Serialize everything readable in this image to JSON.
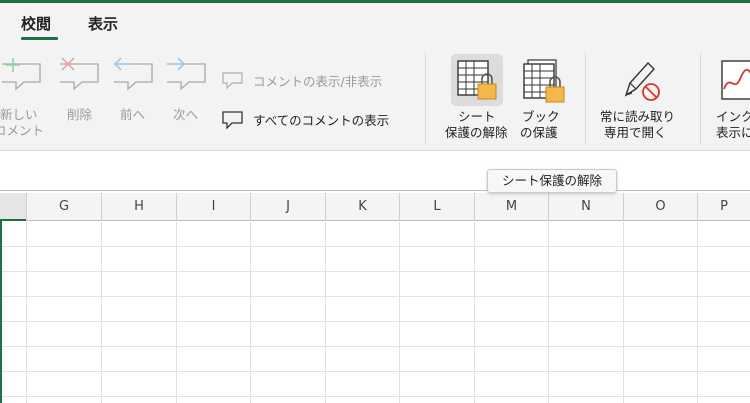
{
  "tabs": [
    {
      "label": "校閲",
      "active": true
    },
    {
      "label": "表示",
      "active": false
    }
  ],
  "ribbon": {
    "new_comment": {
      "line1": "新しい",
      "line2": "コメント",
      "enabled": false
    },
    "delete": {
      "label": "削除",
      "enabled": false
    },
    "prev": {
      "label": "前へ",
      "enabled": false
    },
    "next": {
      "label": "次へ",
      "enabled": false
    },
    "show_hide_comment": {
      "label": "コメントの表示/非表示",
      "enabled": false
    },
    "show_all_comments": {
      "label": "すべてのコメントの表示",
      "enabled": true
    },
    "unprotect_sheet": {
      "line1": "シート",
      "line2": "保護の解除",
      "pressed": true
    },
    "protect_workbook": {
      "line1": "ブック",
      "line2": "の保護"
    },
    "always_read_only": {
      "line1": "常に読み取り",
      "line2": "専用で開く"
    },
    "ink": {
      "line1": "インク",
      "line2": "表示に"
    }
  },
  "tooltip": {
    "text": "シート保護の解除"
  },
  "columns": [
    "G",
    "H",
    "I",
    "J",
    "K",
    "L",
    "M",
    "N",
    "O",
    "P"
  ],
  "colors": {
    "accent": "#1e7145",
    "lock": "#f2b84a",
    "ink_red": "#d9362b",
    "disabled_red": "#f0a7a7",
    "disabled_green": "#8fd4a8",
    "disabled_blue": "#9cc8ec"
  }
}
